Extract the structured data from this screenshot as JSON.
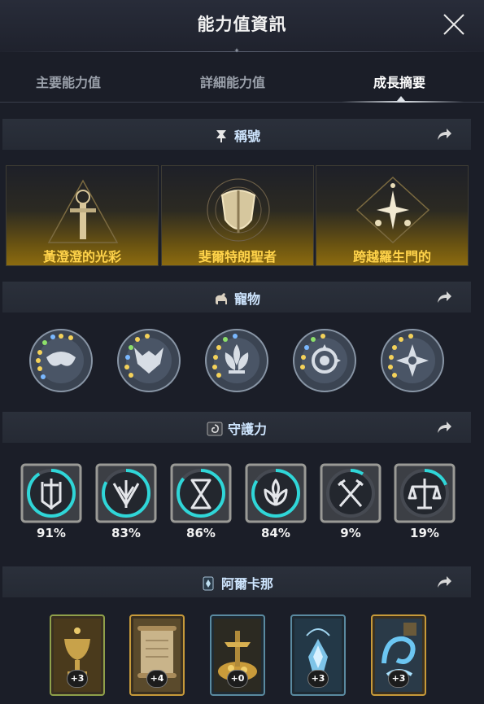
{
  "window": {
    "title": "能力值資訊"
  },
  "tabs": [
    {
      "label": "主要能力值",
      "active": false
    },
    {
      "label": "詳細能力值",
      "active": false
    },
    {
      "label": "成長摘要",
      "active": true
    }
  ],
  "sections": {
    "titles": {
      "label": "稱號",
      "items": [
        {
          "name": "黃澄澄的光彩",
          "icon": "sword-triangle-emblem"
        },
        {
          "name": "斐爾特朗聖者",
          "icon": "shield-circle-emblem"
        },
        {
          "name": "跨越羅生門的",
          "icon": "star-diamond-emblem"
        }
      ]
    },
    "pets": {
      "label": "寵物",
      "items": [
        {
          "icon": "mask-pet-medallion"
        },
        {
          "icon": "dragon-pet-medallion"
        },
        {
          "icon": "lotus-pet-medallion"
        },
        {
          "icon": "swirl-pet-medallion"
        },
        {
          "icon": "flower-pet-medallion"
        }
      ]
    },
    "guardian": {
      "label": "守護力",
      "items": [
        {
          "value": "91%",
          "progress": 0.91,
          "icon": "sword-shield-guardian"
        },
        {
          "value": "83%",
          "progress": 0.83,
          "icon": "wing-shield-guardian"
        },
        {
          "value": "86%",
          "progress": 0.86,
          "icon": "hourglass-guardian"
        },
        {
          "value": "84%",
          "progress": 0.84,
          "icon": "lotus-guardian"
        },
        {
          "value": "9%",
          "progress": 0.09,
          "icon": "crossed-axes-guardian"
        },
        {
          "value": "19%",
          "progress": 0.19,
          "icon": "scales-guardian"
        }
      ]
    },
    "arcana": {
      "label": "阿爾卡那",
      "items": [
        {
          "level": "+3",
          "icon": "chalice-card",
          "frame": "#8fa04a"
        },
        {
          "level": "+4",
          "icon": "scroll-card",
          "frame": "#c79a3a"
        },
        {
          "level": "+0",
          "icon": "treasure-card",
          "frame": "#5a8aa0"
        },
        {
          "level": "+3",
          "icon": "ice-crystal-card",
          "frame": "#5a8aa0"
        },
        {
          "level": "+3",
          "icon": "water-swirl-card",
          "frame": "#c79a3a"
        }
      ]
    }
  },
  "colors": {
    "background": "#1b1e28",
    "title_text": "#ffd34a",
    "guardian_ring": "#2fd6d8",
    "section_label": "#cfe6ff"
  }
}
